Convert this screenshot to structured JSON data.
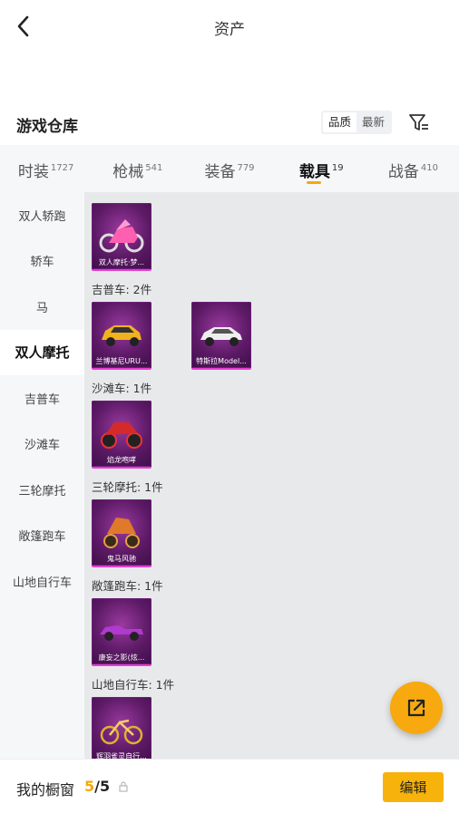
{
  "header": {
    "title": "资产",
    "back_icon": "chevron-left-icon"
  },
  "section": {
    "title": "游戏仓库",
    "sort": [
      "品质",
      "最新"
    ],
    "sort_active": "品质",
    "filter_icon": "filter-icon"
  },
  "tabs": [
    {
      "label": "时装",
      "count": "1727"
    },
    {
      "label": "枪械",
      "count": "541"
    },
    {
      "label": "装备",
      "count": "779"
    },
    {
      "label": "载具",
      "count": "19",
      "active": true
    },
    {
      "label": "战备",
      "count": "410"
    }
  ],
  "sidebar": [
    "双人轿跑",
    "轿车",
    "马",
    "双人摩托",
    "吉普车",
    "沙滩车",
    "三轮摩托",
    "敞篷跑车",
    "山地自行车"
  ],
  "sidebar_active": "双人摩托",
  "groups": [
    {
      "label": "吉普车: 2件",
      "items": [
        "兰博基尼URU...",
        "特斯拉Model..."
      ]
    },
    {
      "label": "沙滩车: 1件",
      "items": [
        "焰龙咆哮"
      ]
    },
    {
      "label": "三轮摩托: 1件",
      "items": [
        "鬼马风驰"
      ]
    },
    {
      "label": "敞篷跑车: 1件",
      "items": [
        "康妄之影(炫..."
      ]
    },
    {
      "label": "山地自行车: 1件",
      "items": [
        "辉羽雀灵自行..."
      ]
    }
  ],
  "first_card": "双人摩托·梦...",
  "bottom": {
    "showcase_label": "我的橱窗",
    "count_current": "5",
    "count_total": "5",
    "edit_label": "编辑"
  },
  "colors": {
    "accent": "#f5a80c",
    "card_bg": "#5d1a66",
    "card_border": "#e63fd1"
  }
}
